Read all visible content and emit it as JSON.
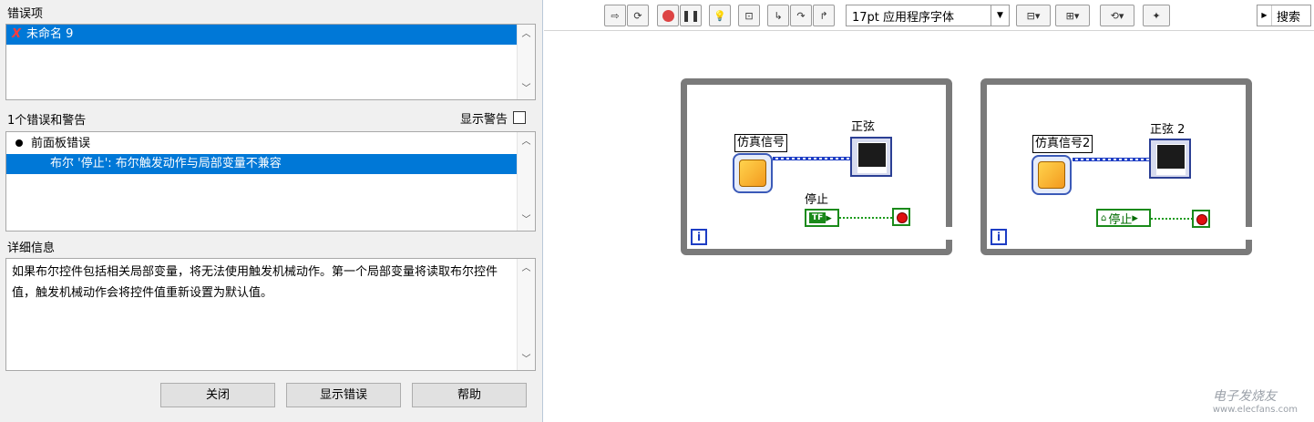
{
  "error_dialog": {
    "items_label": "错误项",
    "items": [
      {
        "mark": "X",
        "label": "未命名 9",
        "selected": true
      }
    ],
    "errors_label": "1个错误和警告",
    "show_warnings_label": "显示警告",
    "show_warnings_checked": false,
    "errors": [
      {
        "label": "前面板错误",
        "type": "group"
      },
      {
        "label": "布尔 '停止': 布尔触发动作与局部变量不兼容",
        "type": "error",
        "selected": true
      }
    ],
    "details_label": "详细信息",
    "details_text": "如果布尔控件包括相关局部变量，将无法使用触发机械动作。第一个局部变量将读取布尔控件值，触发机械动作会将控件值重新设置为默认值。",
    "buttons": {
      "close": "关闭",
      "show_error": "显示错误",
      "help": "帮助"
    }
  },
  "block_diagram": {
    "toolbar": {
      "font_selector": "17pt 应用程序字体",
      "search_label": "搜索",
      "icons": [
        "run-arrow-icon",
        "run-continuously-icon",
        "abort-icon",
        "pause-icon",
        "highlight-execution-icon",
        "retain-wire-values-icon",
        "step-into-icon",
        "step-over-icon",
        "step-out-icon",
        "align-objects-icon",
        "distribute-objects-icon",
        "reorder-icon",
        "cleanup-diagram-icon"
      ]
    },
    "loops": [
      {
        "sim_label": "仿真信号",
        "graph_label": "正弦",
        "stop_label": "停止",
        "iteration_symbol": "i",
        "tf_text": "TF",
        "stop_variant": "control"
      },
      {
        "sim_label": "仿真信号2",
        "graph_label": "正弦 2",
        "stop_label": "停止",
        "iteration_symbol": "i",
        "stop_variant": "local-variable"
      }
    ],
    "watermark": {
      "line1": "电子发烧友",
      "line2": "www.elecfans.com"
    }
  },
  "colors": {
    "selection": "#0078d7",
    "loop_border": "#7a7a7a",
    "bool_wire": "#1a9a1a",
    "dynamic_wire": "#1d3dc4",
    "stop_red": "#e01010"
  }
}
